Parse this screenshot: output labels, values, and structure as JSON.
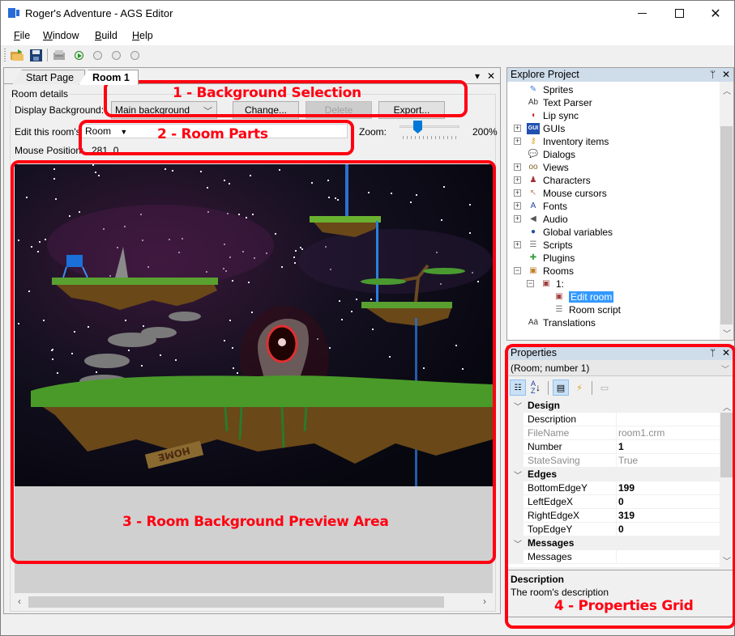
{
  "window": {
    "title": "Roger's Adventure - AGS Editor",
    "controls": [
      "minimize",
      "maximize",
      "close"
    ]
  },
  "menubar": {
    "items": [
      {
        "label": "File",
        "accel": "F"
      },
      {
        "label": "Window",
        "accel": "W"
      },
      {
        "label": "Build",
        "accel": "B"
      },
      {
        "label": "Help",
        "accel": "H"
      }
    ]
  },
  "toolbar": {
    "buttons": [
      "open-project-icon",
      "save-icon",
      "build-exe-icon",
      "run-icon",
      "pause-icon",
      "step-icon",
      "stop-icon"
    ]
  },
  "document": {
    "tabs": [
      {
        "label": "Start Page",
        "active": false
      },
      {
        "label": "Room 1",
        "active": true
      }
    ],
    "tab_menu_glyph": "▾",
    "tab_close_glyph": "✕",
    "group_label": "Room details",
    "display_background_label": "Display Background:",
    "display_background_value": "Main background",
    "change_button": "Change...",
    "delete_button": "Delete",
    "export_button": "Export...",
    "edit_room_label": "Edit this room's:",
    "edit_room_value": "Room",
    "zoom_label": "Zoom:",
    "zoom_value": "200%",
    "zoom_level_fraction": 0.25,
    "mouse_position_label": "Mouse Position:",
    "mouse_position_value": "281, 0",
    "sign_text": "HOME"
  },
  "explorer": {
    "title": "Explore Project",
    "items": [
      {
        "label": "Sprites",
        "icon": "sprites-icon",
        "expandable": false,
        "level": 0
      },
      {
        "label": "Text Parser",
        "icon": "text-parser-icon",
        "expandable": false,
        "level": 0
      },
      {
        "label": "Lip sync",
        "icon": "lip-sync-icon",
        "expandable": false,
        "level": 0
      },
      {
        "label": "GUIs",
        "icon": "gui-icon",
        "expandable": true,
        "level": 0
      },
      {
        "label": "Inventory items",
        "icon": "inventory-icon",
        "expandable": true,
        "level": 0
      },
      {
        "label": "Dialogs",
        "icon": "dialogs-icon",
        "expandable": false,
        "level": 0
      },
      {
        "label": "Views",
        "icon": "views-icon",
        "expandable": true,
        "level": 0
      },
      {
        "label": "Characters",
        "icon": "characters-icon",
        "expandable": true,
        "level": 0
      },
      {
        "label": "Mouse cursors",
        "icon": "mouse-cursors-icon",
        "expandable": true,
        "level": 0
      },
      {
        "label": "Fonts",
        "icon": "fonts-icon",
        "expandable": true,
        "level": 0
      },
      {
        "label": "Audio",
        "icon": "audio-icon",
        "expandable": true,
        "level": 0
      },
      {
        "label": "Global variables",
        "icon": "global-variables-icon",
        "expandable": false,
        "level": 0
      },
      {
        "label": "Scripts",
        "icon": "scripts-icon",
        "expandable": true,
        "level": 0
      },
      {
        "label": "Plugins",
        "icon": "plugins-icon",
        "expandable": false,
        "level": 0
      },
      {
        "label": "Rooms",
        "icon": "rooms-icon",
        "expandable": true,
        "expanded": true,
        "level": 0
      },
      {
        "label": "1:",
        "icon": "room-icon",
        "expandable": true,
        "expanded": true,
        "level": 1
      },
      {
        "label": "Edit room",
        "icon": "edit-room-icon",
        "expandable": false,
        "level": 2,
        "selected": true
      },
      {
        "label": "Room script",
        "icon": "room-script-icon",
        "expandable": false,
        "level": 2
      },
      {
        "label": "Translations",
        "icon": "translations-icon",
        "expandable": false,
        "level": 0
      }
    ]
  },
  "properties": {
    "title": "Properties",
    "selected_object": "(Room; number 1)",
    "toolbar": [
      "categorized-icon",
      "alphabetical-icon",
      "properties-icon",
      "events-icon",
      "property-pages-icon"
    ],
    "rows": [
      {
        "type": "category",
        "name": "Design"
      },
      {
        "type": "prop",
        "name": "Description",
        "value": "",
        "readonly": false,
        "bold": false
      },
      {
        "type": "prop",
        "name": "FileName",
        "value": "room1.crm",
        "readonly": true,
        "bold": false
      },
      {
        "type": "prop",
        "name": "Number",
        "value": "1",
        "readonly": false,
        "bold": true
      },
      {
        "type": "prop",
        "name": "StateSaving",
        "value": "True",
        "readonly": true,
        "bold": false
      },
      {
        "type": "category",
        "name": "Edges"
      },
      {
        "type": "prop",
        "name": "BottomEdgeY",
        "value": "199",
        "readonly": false,
        "bold": true
      },
      {
        "type": "prop",
        "name": "LeftEdgeX",
        "value": "0",
        "readonly": false,
        "bold": true
      },
      {
        "type": "prop",
        "name": "RightEdgeX",
        "value": "319",
        "readonly": false,
        "bold": true
      },
      {
        "type": "prop",
        "name": "TopEdgeY",
        "value": "0",
        "readonly": false,
        "bold": true
      },
      {
        "type": "category",
        "name": "Messages"
      },
      {
        "type": "prop",
        "name": "Messages",
        "value": "",
        "readonly": false,
        "bold": false
      }
    ],
    "description_title": "Description",
    "description_text": "The room's description"
  },
  "annotations": [
    {
      "label": "1 - Background Selection",
      "color": "#ff0011"
    },
    {
      "label": "2 - Room Parts",
      "color": "#ff0011"
    },
    {
      "label": "3 - Room Background Preview Area",
      "color": "#ff0011"
    },
    {
      "label": "4 - Properties Grid",
      "color": "#ff0011"
    }
  ],
  "colors": {
    "selection": "#3399ff",
    "panel_header": "#cfdcea",
    "annotation": "#ff0011",
    "zoom_thumb": "#0078d7"
  }
}
